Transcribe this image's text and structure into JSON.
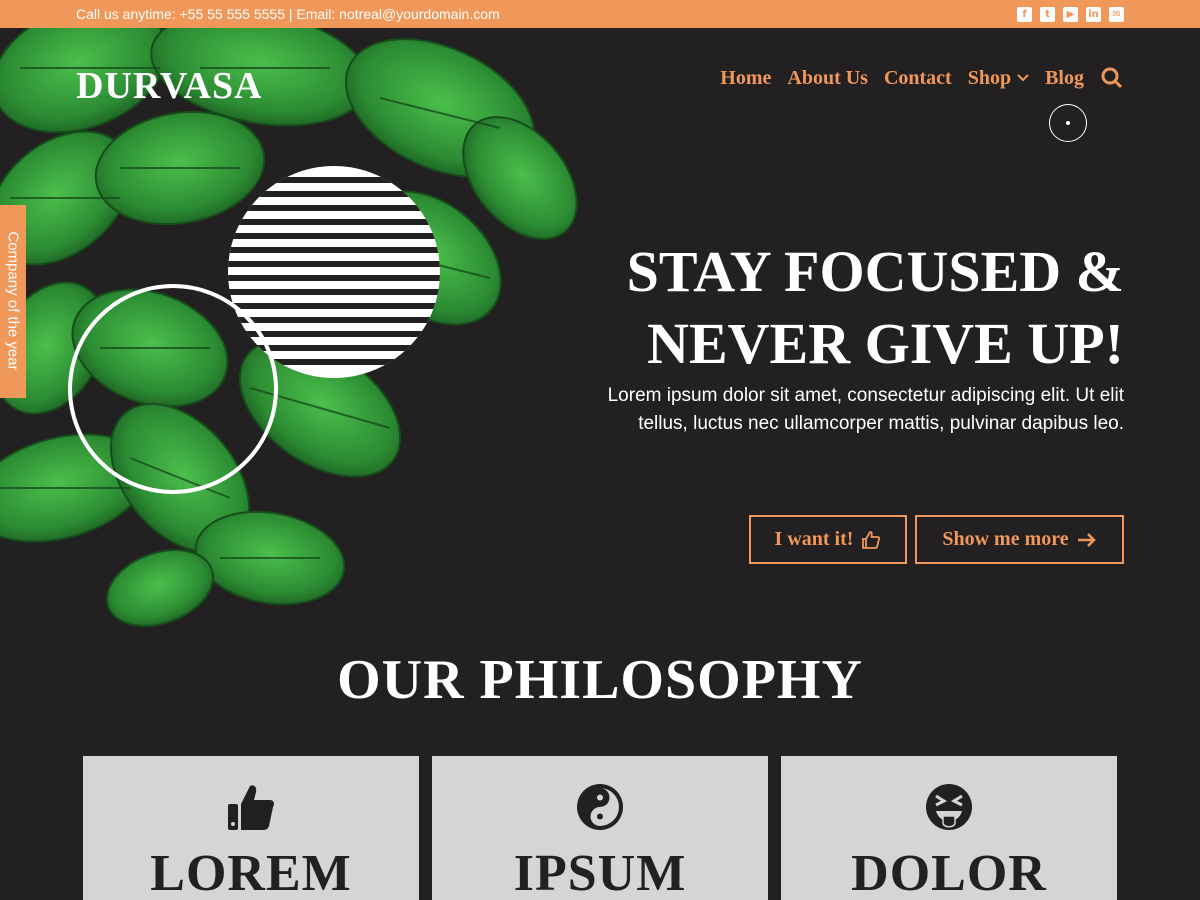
{
  "topbar": {
    "contact": "Call us anytime: +55 55 555 5555 | Email: notreal@yourdomain.com",
    "social": [
      {
        "icon": "facebook-icon",
        "glyph": "f"
      },
      {
        "icon": "twitter-icon",
        "glyph": "t"
      },
      {
        "icon": "youtube-icon",
        "glyph": "▶"
      },
      {
        "icon": "linkedin-icon",
        "glyph": "in"
      },
      {
        "icon": "envelope-icon",
        "glyph": "✉"
      }
    ]
  },
  "brand": {
    "logo": "DURVASA"
  },
  "nav": {
    "items": [
      {
        "label": "Home"
      },
      {
        "label": "About Us"
      },
      {
        "label": "Contact"
      },
      {
        "label": "Shop"
      },
      {
        "label": "Blog"
      }
    ]
  },
  "sidetab": {
    "label": "Company of the year"
  },
  "hero": {
    "headline": "STAY FOCUSED & NEVER GIVE UP!",
    "lead": "Lorem ipsum dolor sit amet, consectetur adipiscing elit. Ut elit tellus, luctus nec ullamcorper mattis, pulvinar dapibus leo.",
    "primary_button": "I want it!",
    "secondary_button": "Show me more"
  },
  "philosophy": {
    "title": "OUR PHILOSOPHY",
    "cards": [
      {
        "title": "LOREM",
        "icon": "thumbs-up-icon"
      },
      {
        "title": "IPSUM",
        "icon": "yin-yang-icon"
      },
      {
        "title": "DOLOR",
        "icon": "grin-tongue-squint-icon"
      }
    ]
  },
  "colors": {
    "accent": "#f0975a",
    "background": "#222021",
    "card": "#d5d5d5",
    "leaf": "#2f9a3a"
  }
}
